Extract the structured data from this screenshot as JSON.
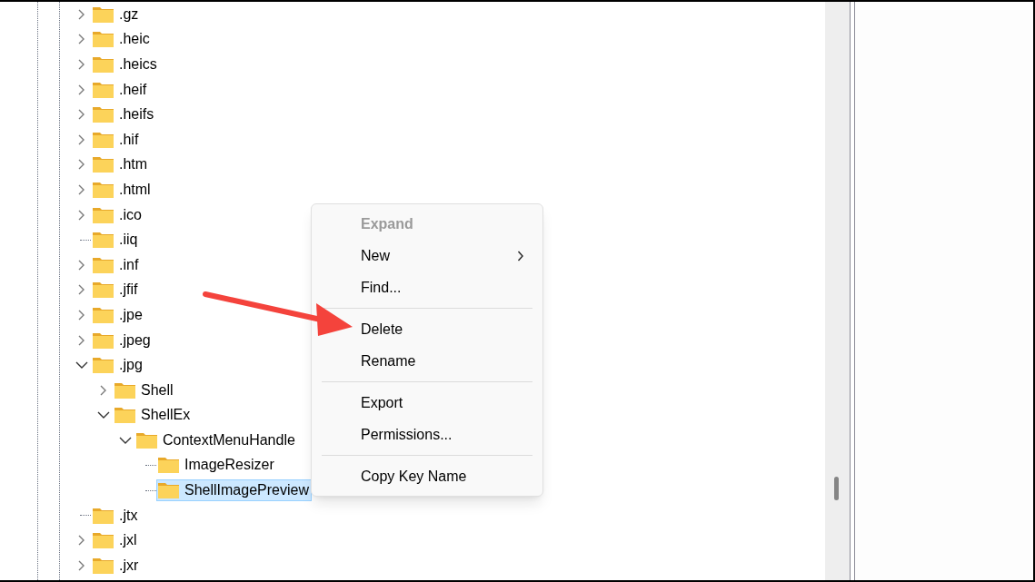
{
  "tree": [
    {
      "label": ".gz",
      "kind": "branch",
      "expanded": false,
      "selected": false
    },
    {
      "label": ".heic",
      "kind": "branch",
      "expanded": false,
      "selected": false
    },
    {
      "label": ".heics",
      "kind": "branch",
      "expanded": false,
      "selected": false
    },
    {
      "label": ".heif",
      "kind": "branch",
      "expanded": false,
      "selected": false
    },
    {
      "label": ".heifs",
      "kind": "branch",
      "expanded": false,
      "selected": false
    },
    {
      "label": ".hif",
      "kind": "branch",
      "expanded": false,
      "selected": false
    },
    {
      "label": ".htm",
      "kind": "branch",
      "expanded": false,
      "selected": false
    },
    {
      "label": ".html",
      "kind": "branch",
      "expanded": false,
      "selected": false
    },
    {
      "label": ".ico",
      "kind": "branch",
      "expanded": false,
      "selected": false
    },
    {
      "label": ".iiq",
      "kind": "leaf",
      "selected": false
    },
    {
      "label": ".inf",
      "kind": "branch",
      "expanded": false,
      "selected": false
    },
    {
      "label": ".jfif",
      "kind": "branch",
      "expanded": false,
      "selected": false
    },
    {
      "label": ".jpe",
      "kind": "branch",
      "expanded": false,
      "selected": false
    },
    {
      "label": ".jpeg",
      "kind": "branch",
      "expanded": false,
      "selected": false
    },
    {
      "label": ".jpg",
      "kind": "branch",
      "expanded": true,
      "selected": false,
      "children": [
        {
          "label": "Shell",
          "kind": "branch",
          "expanded": false,
          "selected": false
        },
        {
          "label": "ShellEx",
          "kind": "branch",
          "expanded": true,
          "selected": false,
          "children": [
            {
              "label": "ContextMenuHandle",
              "kind": "branch",
              "expanded": true,
              "selected": false,
              "children": [
                {
                  "label": "ImageResizer",
                  "kind": "leaf",
                  "selected": false
                },
                {
                  "label": "ShellImagePreview",
                  "kind": "leaf",
                  "selected": true
                }
              ]
            }
          ]
        }
      ]
    },
    {
      "label": ".jtx",
      "kind": "leaf",
      "selected": false
    },
    {
      "label": ".jxl",
      "kind": "branch",
      "expanded": false,
      "selected": false
    },
    {
      "label": ".jxr",
      "kind": "branch",
      "expanded": false,
      "selected": false
    }
  ],
  "context_menu": [
    {
      "kind": "item",
      "label": "Expand",
      "disabled": true,
      "submenu": false
    },
    {
      "kind": "item",
      "label": "New",
      "disabled": false,
      "submenu": true
    },
    {
      "kind": "item",
      "label": "Find...",
      "disabled": false,
      "submenu": false
    },
    {
      "kind": "separator"
    },
    {
      "kind": "item",
      "label": "Delete",
      "disabled": false,
      "submenu": false
    },
    {
      "kind": "item",
      "label": "Rename",
      "disabled": false,
      "submenu": false
    },
    {
      "kind": "separator"
    },
    {
      "kind": "item",
      "label": "Export",
      "disabled": false,
      "submenu": false
    },
    {
      "kind": "item",
      "label": "Permissions...",
      "disabled": false,
      "submenu": false
    },
    {
      "kind": "separator"
    },
    {
      "kind": "item",
      "label": "Copy Key Name",
      "disabled": false,
      "submenu": false
    }
  ]
}
